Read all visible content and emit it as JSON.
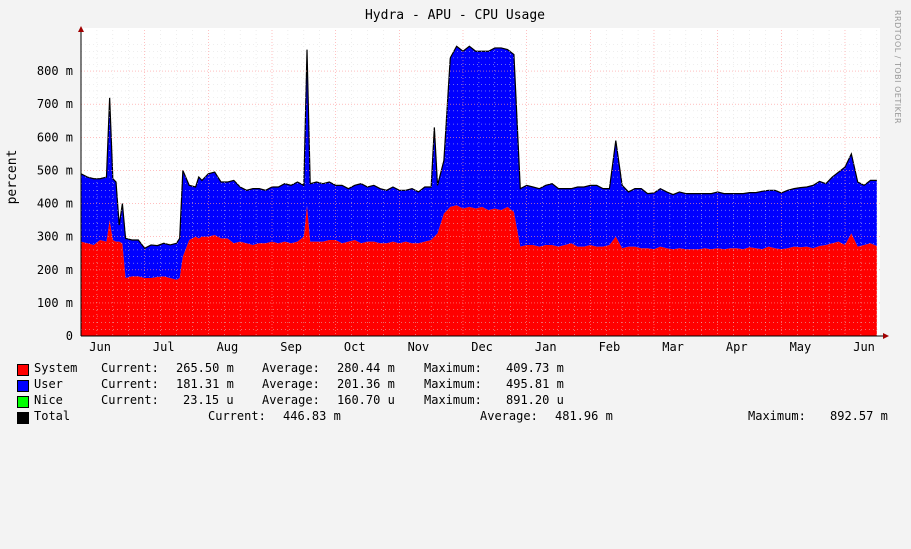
{
  "chart_data": {
    "type": "area",
    "title": "Hydra - APU - CPU Usage",
    "ylabel": "percent",
    "ylim": [
      0,
      900
    ],
    "y_ticks": [
      {
        "value": 0,
        "label": "0"
      },
      {
        "value": 100,
        "label": "100 m"
      },
      {
        "value": 200,
        "label": "200 m"
      },
      {
        "value": 300,
        "label": "300 m"
      },
      {
        "value": 400,
        "label": "400 m"
      },
      {
        "value": 500,
        "label": "500 m"
      },
      {
        "value": 600,
        "label": "600 m"
      },
      {
        "value": 700,
        "label": "700 m"
      },
      {
        "value": 800,
        "label": "800 m"
      }
    ],
    "x_range": [
      0,
      12.55
    ],
    "x_ticks": [
      {
        "pos": 0.3,
        "label": "Jun"
      },
      {
        "pos": 1.3,
        "label": "Jul"
      },
      {
        "pos": 2.3,
        "label": "Aug"
      },
      {
        "pos": 3.3,
        "label": "Sep"
      },
      {
        "pos": 4.3,
        "label": "Oct"
      },
      {
        "pos": 5.3,
        "label": "Nov"
      },
      {
        "pos": 6.3,
        "label": "Dec"
      },
      {
        "pos": 7.3,
        "label": "Jan"
      },
      {
        "pos": 8.3,
        "label": "Feb"
      },
      {
        "pos": 9.3,
        "label": "Mar"
      },
      {
        "pos": 10.3,
        "label": "Apr"
      },
      {
        "pos": 11.3,
        "label": "May"
      },
      {
        "pos": 12.3,
        "label": "Jun"
      }
    ],
    "grid": true,
    "stacked": true,
    "x": [
      0,
      0.1,
      0.2,
      0.3,
      0.4,
      0.45,
      0.5,
      0.55,
      0.6,
      0.65,
      0.7,
      0.8,
      0.9,
      1.0,
      1.1,
      1.2,
      1.3,
      1.4,
      1.5,
      1.55,
      1.6,
      1.7,
      1.8,
      1.85,
      1.9,
      2.0,
      2.1,
      2.2,
      2.3,
      2.4,
      2.5,
      2.6,
      2.7,
      2.8,
      2.9,
      3.0,
      3.1,
      3.2,
      3.3,
      3.4,
      3.5,
      3.55,
      3.6,
      3.7,
      3.8,
      3.9,
      4.0,
      4.1,
      4.2,
      4.3,
      4.4,
      4.5,
      4.6,
      4.7,
      4.8,
      4.9,
      5.0,
      5.1,
      5.2,
      5.3,
      5.4,
      5.5,
      5.55,
      5.6,
      5.7,
      5.8,
      5.9,
      6.0,
      6.1,
      6.2,
      6.3,
      6.4,
      6.5,
      6.6,
      6.7,
      6.8,
      6.9,
      7.0,
      7.1,
      7.2,
      7.3,
      7.4,
      7.5,
      7.6,
      7.7,
      7.8,
      7.9,
      8.0,
      8.1,
      8.2,
      8.3,
      8.4,
      8.5,
      8.6,
      8.7,
      8.8,
      8.9,
      9.0,
      9.1,
      9.2,
      9.3,
      9.4,
      9.5,
      9.6,
      9.7,
      9.8,
      9.9,
      10.0,
      10.1,
      10.2,
      10.3,
      10.4,
      10.5,
      10.6,
      10.7,
      10.8,
      10.9,
      11.0,
      11.1,
      11.2,
      11.3,
      11.4,
      11.5,
      11.6,
      11.7,
      11.8,
      11.9,
      12.0,
      12.1,
      12.2,
      12.3,
      12.4,
      12.5
    ],
    "series": [
      {
        "name": "System",
        "color": "#ff0000",
        "values": [
          285,
          280,
          275,
          290,
          285,
          350,
          290,
          285,
          285,
          280,
          175,
          180,
          180,
          175,
          175,
          178,
          180,
          175,
          170,
          175,
          240,
          290,
          300,
          295,
          300,
          300,
          305,
          295,
          295,
          280,
          285,
          280,
          275,
          280,
          280,
          285,
          280,
          285,
          280,
          285,
          300,
          395,
          285,
          285,
          285,
          290,
          290,
          280,
          285,
          290,
          280,
          285,
          285,
          280,
          280,
          285,
          280,
          285,
          280,
          280,
          285,
          290,
          300,
          310,
          370,
          390,
          395,
          385,
          390,
          385,
          390,
          380,
          385,
          380,
          390,
          375,
          270,
          275,
          275,
          270,
          275,
          275,
          270,
          275,
          280,
          270,
          270,
          275,
          270,
          270,
          275,
          300,
          265,
          270,
          270,
          265,
          265,
          262,
          270,
          265,
          262,
          265,
          262,
          262,
          262,
          265,
          262,
          265,
          262,
          265,
          265,
          262,
          268,
          265,
          262,
          270,
          265,
          262,
          265,
          270,
          268,
          270,
          265,
          272,
          275,
          280,
          285,
          275,
          310,
          270,
          275,
          280,
          272,
          270,
          266
        ]
      },
      {
        "name": "User",
        "color": "#0000ff",
        "values": [
          205,
          200,
          200,
          185,
          195,
          370,
          185,
          180,
          50,
          120,
          120,
          110,
          110,
          90,
          100,
          95,
          100,
          100,
          110,
          120,
          260,
          165,
          150,
          185,
          170,
          190,
          190,
          170,
          170,
          190,
          165,
          160,
          170,
          165,
          160,
          165,
          170,
          175,
          175,
          180,
          155,
          470,
          175,
          180,
          175,
          175,
          165,
          175,
          160,
          165,
          180,
          165,
          170,
          165,
          160,
          165,
          160,
          155,
          165,
          155,
          165,
          160,
          330,
          145,
          160,
          450,
          480,
          475,
          485,
          475,
          470,
          480,
          485,
          490,
          475,
          475,
          175,
          180,
          175,
          175,
          180,
          185,
          175,
          170,
          165,
          180,
          180,
          180,
          185,
          175,
          170,
          290,
          190,
          165,
          175,
          180,
          165,
          170,
          175,
          170,
          165,
          170,
          168,
          168,
          168,
          165,
          168,
          170,
          168,
          165,
          165,
          168,
          165,
          168,
          175,
          170,
          175,
          170,
          175,
          175,
          180,
          180,
          190,
          195,
          185,
          200,
          210,
          235,
          240,
          195,
          180,
          190,
          198,
          190,
          181
        ]
      },
      {
        "name": "Nice",
        "color": "#00ff00",
        "values": [
          0.02,
          0.02,
          0.02,
          0.02,
          0.02,
          0.02,
          0.02,
          0.02,
          0.02,
          0.02,
          0.02,
          0.02,
          0.02,
          0.02,
          0.02,
          0.02,
          0.02,
          0.02,
          0.02,
          0.02,
          0.02,
          0.02,
          0.02,
          0.02,
          0.02,
          0.02,
          0.02,
          0.02,
          0.02,
          0.02,
          0.02,
          0.02,
          0.02,
          0.02,
          0.02,
          0.02,
          0.02,
          0.02,
          0.02,
          0.02,
          0.02,
          0.02,
          0.02,
          0.02,
          0.02,
          0.02,
          0.02,
          0.02,
          0.02,
          0.02,
          0.02,
          0.02,
          0.02,
          0.02,
          0.02,
          0.02,
          0.02,
          0.02,
          0.02,
          0.02,
          0.02,
          0.02,
          0.02,
          0.02,
          0.02,
          0.02,
          0.02,
          0.02,
          0.02,
          0.02,
          0.02,
          0.02,
          0.02,
          0.02,
          0.02,
          0.02,
          0.02,
          0.02,
          0.02,
          0.02,
          0.02,
          0.02,
          0.02,
          0.02,
          0.02,
          0.02,
          0.02,
          0.02,
          0.02,
          0.02,
          0.02,
          0.02,
          0.02,
          0.02,
          0.02,
          0.02,
          0.02,
          0.02,
          0.02,
          0.02,
          0.02,
          0.02,
          0.02,
          0.02,
          0.02,
          0.02,
          0.02,
          0.02,
          0.02,
          0.02,
          0.02,
          0.02,
          0.02,
          0.02,
          0.02,
          0.02,
          0.02,
          0.02,
          0.02,
          0.02,
          0.02,
          0.02,
          0.02,
          0.02,
          0.02,
          0.02,
          0.02,
          0.02,
          0.02,
          0.02,
          0.02,
          0.02,
          0.02,
          0.02,
          0.02
        ]
      }
    ]
  },
  "legend": [
    {
      "name": "System",
      "color": "#ff0000",
      "current_label": "Current:",
      "current": "265.50 m",
      "average_label": "Average:",
      "average": "280.44 m",
      "maximum_label": "Maximum:",
      "maximum": "409.73 m"
    },
    {
      "name": "User",
      "color": "#0000ff",
      "current_label": "Current:",
      "current": "181.31 m",
      "average_label": "Average:",
      "average": "201.36 m",
      "maximum_label": "Maximum:",
      "maximum": "495.81 m"
    },
    {
      "name": "Nice",
      "color": "#00ff00",
      "current_label": "Current:",
      "current": "23.15 u",
      "average_label": "Average:",
      "average": "160.70 u",
      "maximum_label": "Maximum:",
      "maximum": "891.20 u"
    }
  ],
  "total": {
    "name": "Total",
    "color": "#000000",
    "current_label": "Current:",
    "current": "446.83 m",
    "average_label": "Average:",
    "average": "481.96 m",
    "maximum_label": "Maximum:",
    "maximum": "892.57 m"
  },
  "watermark": "RRDTOOL / TOBI OETIKER"
}
